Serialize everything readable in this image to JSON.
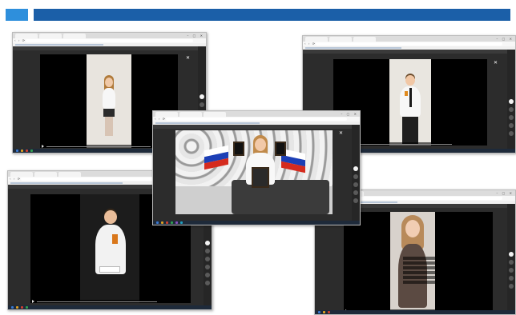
{
  "colors": {
    "header_square": "#2e8fdc",
    "header_bar": "#1b5fa8",
    "flag_white": "#ffffff",
    "flag_blue": "#1c3fb6",
    "flag_red": "#d52b1e"
  },
  "icons": {
    "close": "✕",
    "play": "play-icon",
    "window_controls": "– ▢ ✕",
    "nav": "‹ › ⟳ ⌂"
  },
  "screenshots": [
    {
      "name": "top-left"
    },
    {
      "name": "top-right"
    },
    {
      "name": "center"
    },
    {
      "name": "bottom-left"
    },
    {
      "name": "bottom-right"
    }
  ]
}
